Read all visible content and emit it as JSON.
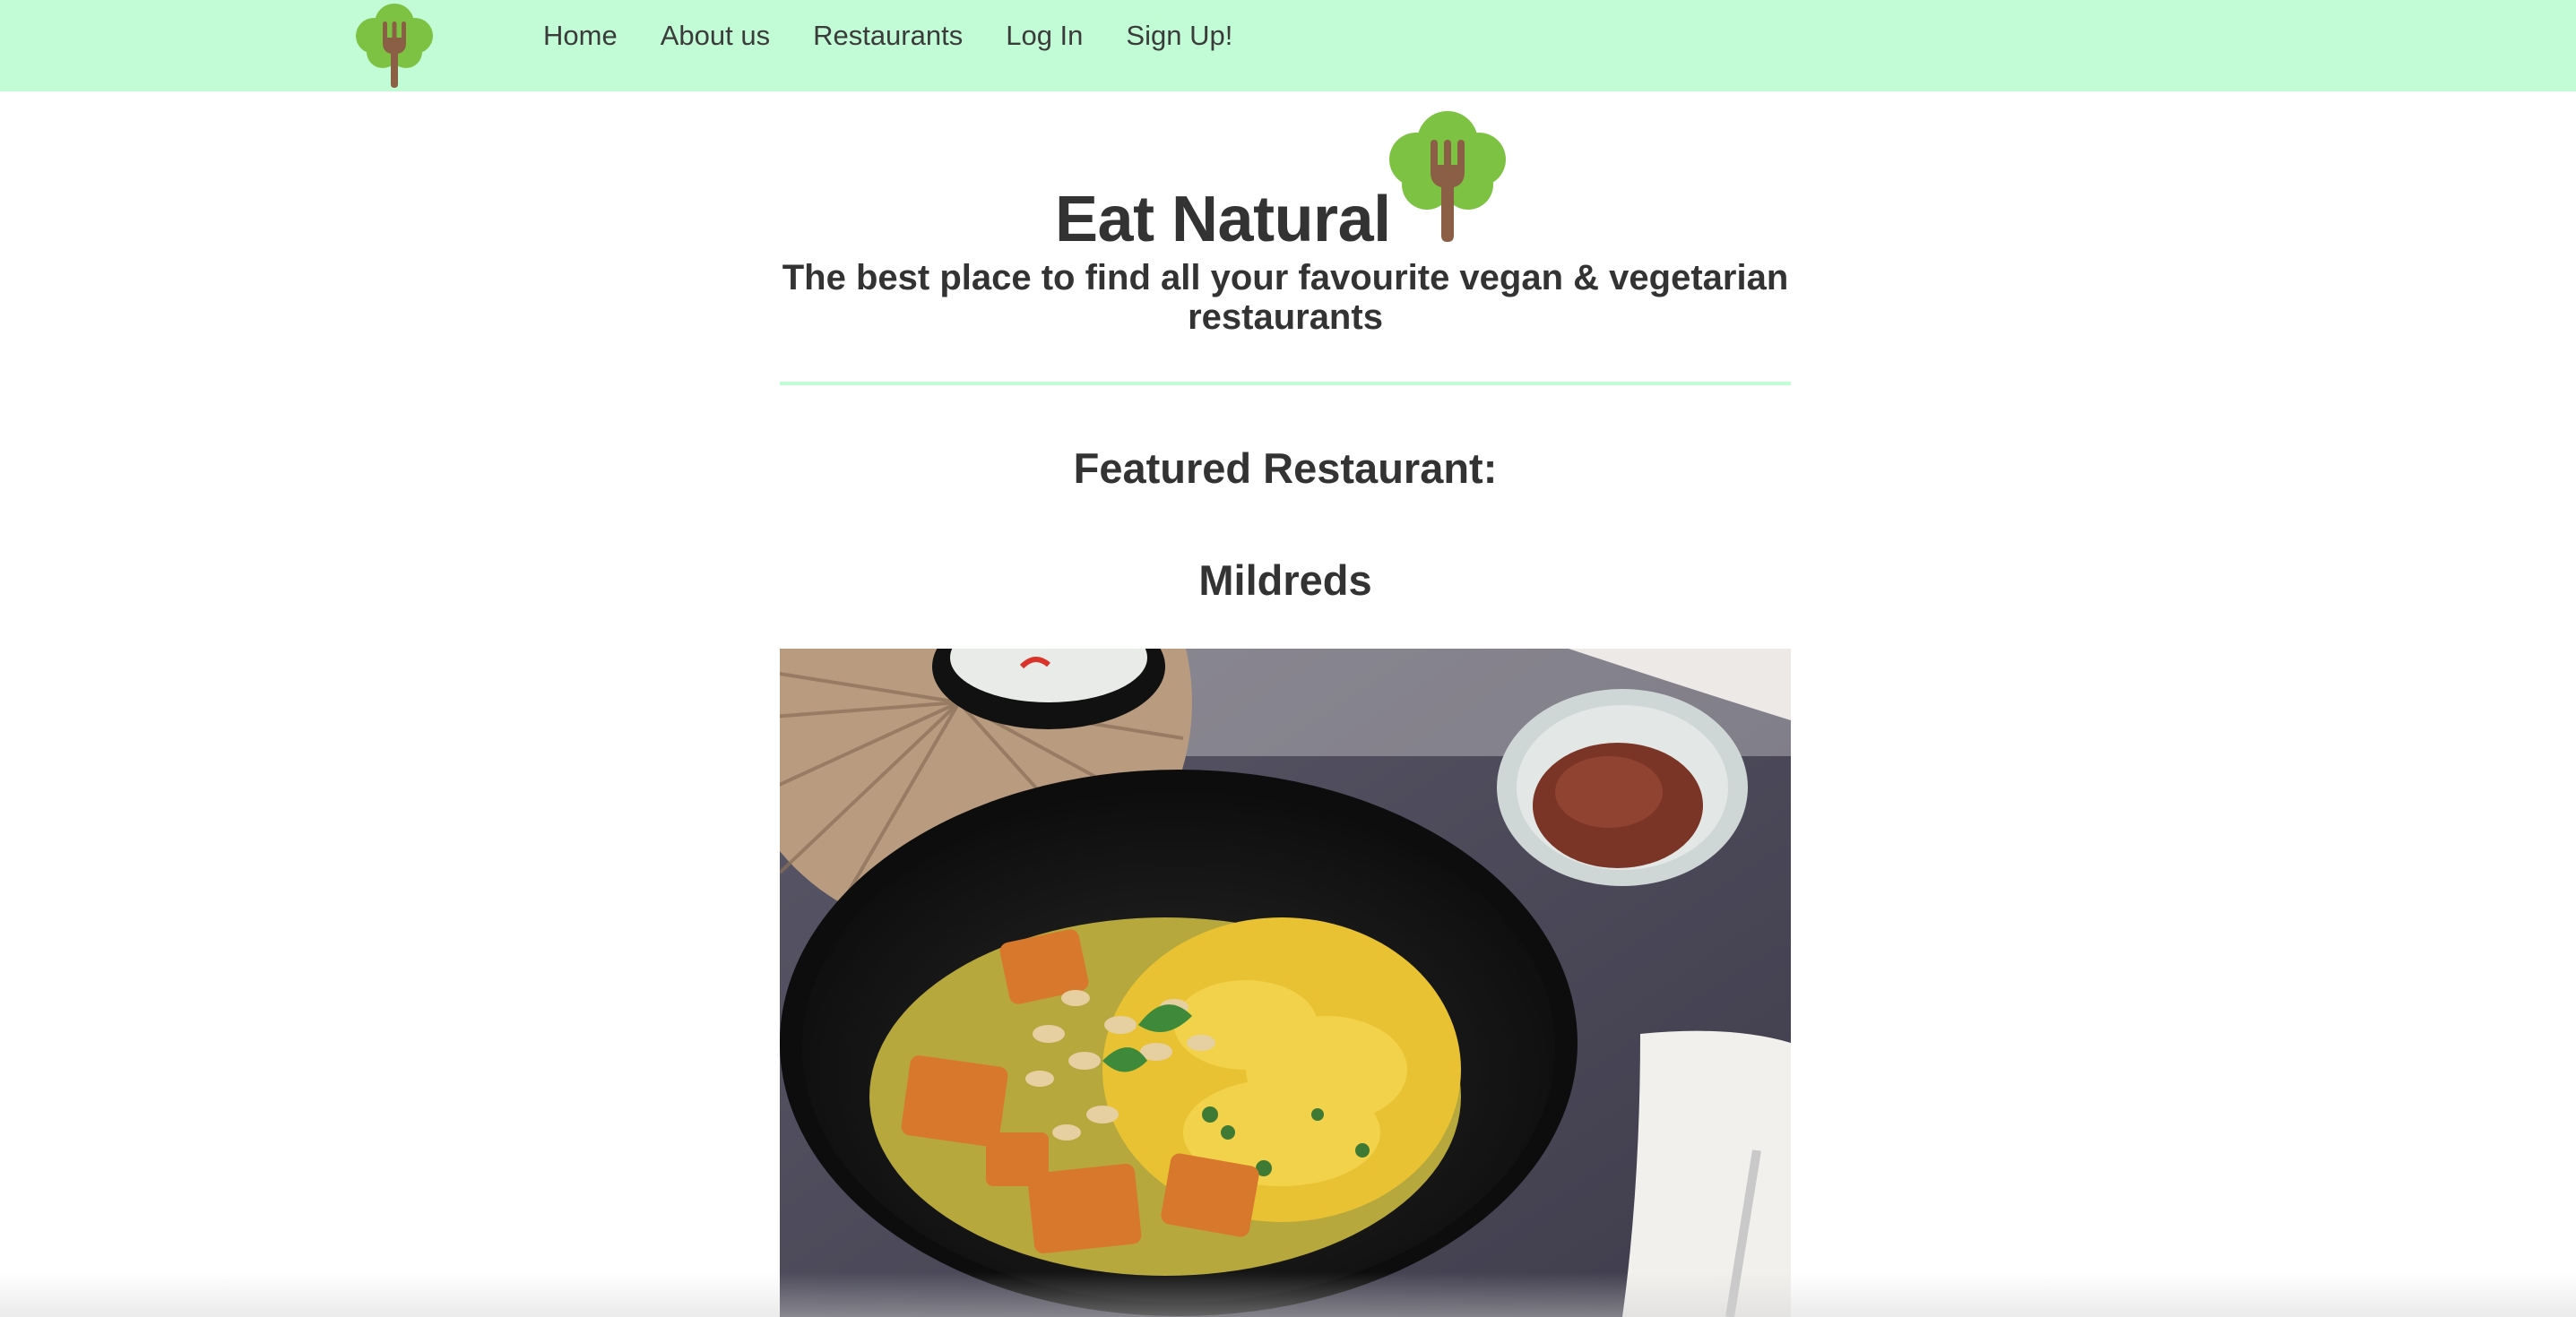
{
  "nav": {
    "logo_icon": "tree-fork-logo-icon",
    "links": [
      "Home",
      "About us",
      "Restaurants",
      "Log In",
      "Sign Up!"
    ]
  },
  "hero": {
    "title": "Eat Natural",
    "logo_icon": "tree-fork-logo-icon",
    "subtitle": "The best place to find all your favourite vegan & vegetarian restaurants"
  },
  "featured": {
    "heading": "Featured Restaurant:",
    "name": "Mildreds",
    "image_alt": "curry-bowl-photo"
  },
  "colors": {
    "nav_bg": "#c2fcd7",
    "divider": "#c2fcd7",
    "tree_green": "#7dc242",
    "fork_brown": "#8b5e46",
    "text": "#333333"
  }
}
